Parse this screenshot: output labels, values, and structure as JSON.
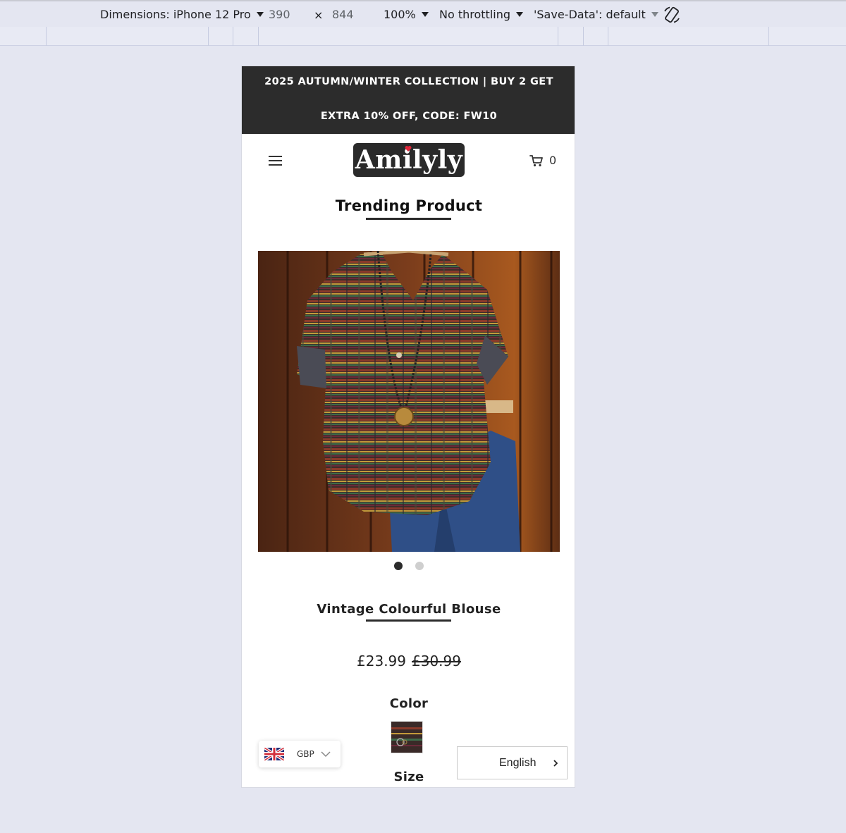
{
  "devtools": {
    "device_label": "Dimensions: iPhone 12 Pro",
    "width": "390",
    "times": "×",
    "height": "844",
    "zoom": "100%",
    "throttling": "No throttling",
    "save_data": "'Save-Data': default",
    "rotate_icon": "rotate-icon"
  },
  "store": {
    "promo_line1": "2025 AUTUMN/WINTER COLLECTION | BUY 2 GET",
    "promo_line2": "EXTRA 10% OFF, CODE: FW10",
    "logo_text": "Amilyly",
    "cart_count": "0",
    "section_title": "Trending Product",
    "product": {
      "name": "Vintage Colourful Blouse",
      "price": "£23.99",
      "old_price": "£30.99",
      "image_slides": 2,
      "active_slide": 1
    },
    "color_label": "Color",
    "size_label": "Size",
    "currency": {
      "code": "GBP",
      "flag_icon": "uk-flag-icon"
    },
    "language": {
      "label": "English"
    }
  },
  "colors": {
    "promo_bg": "#2c2c2c",
    "page_bg": "#e4e6f1",
    "text_dark": "#222222"
  }
}
